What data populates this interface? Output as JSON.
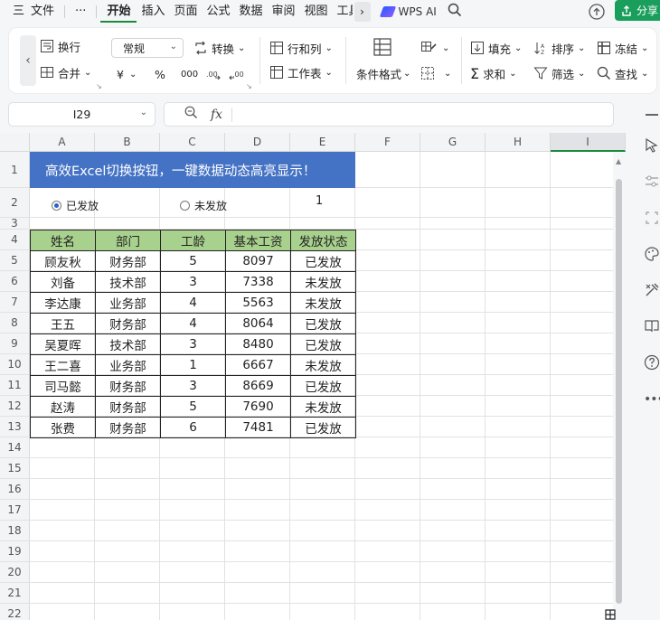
{
  "menu": {
    "hamburger": "三",
    "file": "文件",
    "more": "···",
    "tabs": [
      "开始",
      "插入",
      "页面",
      "公式",
      "数据",
      "审阅",
      "视图",
      "工具"
    ],
    "wps_ai": "WPS AI",
    "share": "分享"
  },
  "ribbon": {
    "wrap_text": "换行",
    "merge": "合并",
    "number_format": "常规",
    "convert": "转换",
    "currency": "¥",
    "percent": "%",
    "thousands": "000",
    "rows_cols": "行和列",
    "worksheet": "工作表",
    "cond_format": "条件格式",
    "fill": "填充",
    "sort": "排序",
    "freeze": "冻结",
    "sum": "求和",
    "filter": "筛选",
    "find": "查找"
  },
  "formula_bar": {
    "cell_ref": "I29",
    "fx": "fx",
    "value": ""
  },
  "sheet": {
    "columns": [
      "A",
      "B",
      "C",
      "D",
      "E",
      "F",
      "G",
      "H",
      "I"
    ],
    "rows": [
      "1",
      "2",
      "3",
      "4",
      "5",
      "6",
      "7",
      "8",
      "9",
      "10",
      "11",
      "12",
      "13",
      "14",
      "15",
      "16",
      "17",
      "18",
      "19",
      "20",
      "21",
      "22"
    ],
    "title": "高效Excel切换按钮，一键数据动态高亮显示！",
    "radio_paid": "已发放",
    "radio_unpaid": "未发放",
    "selected_value": "1",
    "headers": [
      "姓名",
      "部门",
      "工龄",
      "基本工资",
      "发放状态"
    ],
    "records": [
      [
        "顾友秋",
        "财务部",
        "5",
        "8097",
        "已发放"
      ],
      [
        "刘备",
        "技术部",
        "3",
        "7338",
        "未发放"
      ],
      [
        "李达康",
        "业务部",
        "4",
        "5563",
        "未发放"
      ],
      [
        "王五",
        "财务部",
        "4",
        "8064",
        "已发放"
      ],
      [
        "吴夏晖",
        "技术部",
        "3",
        "8480",
        "已发放"
      ],
      [
        "王二喜",
        "业务部",
        "1",
        "6667",
        "未发放"
      ],
      [
        "司马懿",
        "财务部",
        "3",
        "8669",
        "已发放"
      ],
      [
        "赵涛",
        "财务部",
        "5",
        "7690",
        "未发放"
      ],
      [
        "张费",
        "财务部",
        "6",
        "7481",
        "已发放"
      ]
    ]
  },
  "colors": {
    "accent": "#1a8a3e",
    "title_fill": "#4472c4",
    "header_fill": "#a9d18e",
    "share": "#1a9e5b"
  }
}
